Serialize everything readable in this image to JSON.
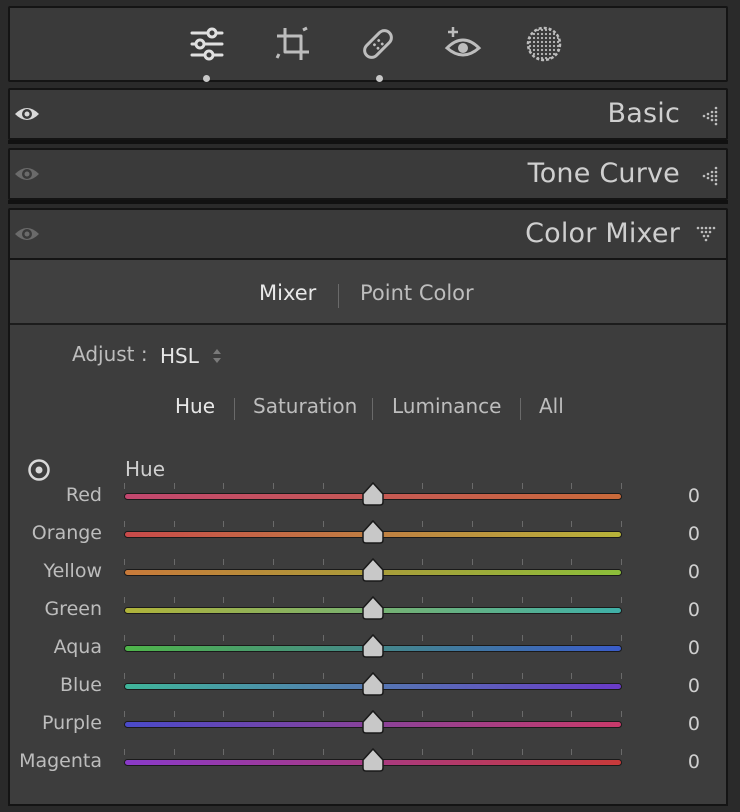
{
  "tools": [
    {
      "name": "edit-sliders-icon",
      "active": true
    },
    {
      "name": "crop-icon",
      "active": false
    },
    {
      "name": "healing-bandage-icon",
      "active": true
    },
    {
      "name": "red-eye-icon",
      "active": false
    },
    {
      "name": "masking-icon",
      "active": false
    }
  ],
  "panels": {
    "basic": "Basic",
    "tone_curve": "Tone Curve",
    "color_mixer": "Color Mixer"
  },
  "mixer": {
    "tabs": [
      "Mixer",
      "Point Color"
    ],
    "active_tab": "Mixer",
    "adjust_label": "Adjust :",
    "adjust_value": "HSL",
    "sub_tabs": [
      "Hue",
      "Saturation",
      "Luminance",
      "All"
    ],
    "active_sub_tab": "Hue",
    "section_title": "Hue",
    "rows": [
      {
        "label": "Red",
        "value": "0",
        "level": 0.5,
        "grad": [
          "#c2476f",
          "#c96a3a"
        ]
      },
      {
        "label": "Orange",
        "value": "0",
        "level": 0.5,
        "grad": [
          "#c94a4a",
          "#b8b43a"
        ]
      },
      {
        "label": "Yellow",
        "value": "0",
        "level": 0.5,
        "grad": [
          "#c97a3a",
          "#8cbf3a"
        ]
      },
      {
        "label": "Green",
        "value": "0",
        "level": 0.5,
        "grad": [
          "#b0b33a",
          "#3fb0a8"
        ]
      },
      {
        "label": "Aqua",
        "value": "0",
        "level": 0.5,
        "grad": [
          "#4fb54a",
          "#3a5cc9"
        ]
      },
      {
        "label": "Blue",
        "value": "0",
        "level": 0.5,
        "grad": [
          "#3fb59a",
          "#6a3ac9"
        ]
      },
      {
        "label": "Purple",
        "value": "0",
        "level": 0.5,
        "grad": [
          "#4a4ac9",
          "#c93a6a"
        ]
      },
      {
        "label": "Magenta",
        "value": "0",
        "level": 0.5,
        "grad": [
          "#8a3ac9",
          "#c93a3a"
        ]
      }
    ]
  }
}
